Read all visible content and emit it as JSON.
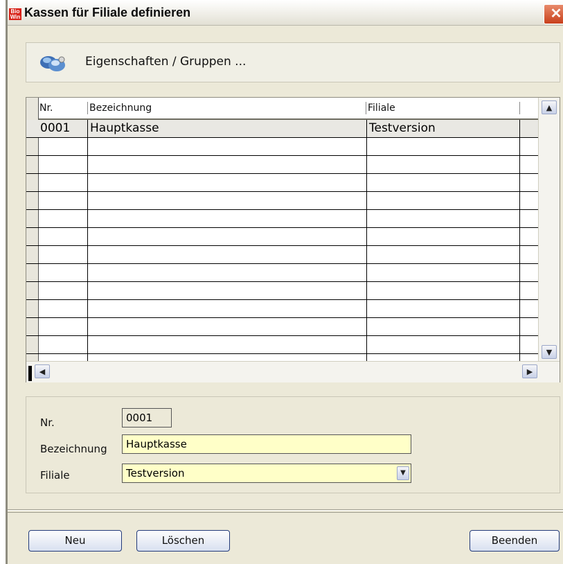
{
  "window": {
    "title": "Kassen für Filiale definieren",
    "app_icon_text": "Bio\nWin",
    "close_glyph": "✕"
  },
  "section": {
    "label": "Eigenschaften / Gruppen ...",
    "icon": "properties-icon"
  },
  "grid": {
    "columns": [
      "Nr.",
      "Bezeichnung",
      "Filiale"
    ],
    "rows": [
      {
        "nr": "0001",
        "bezeichnung": "Hauptkasse",
        "filiale": "Testversion"
      }
    ],
    "scroll_up": "▲",
    "scroll_down": "▼",
    "scroll_left": "◀",
    "scroll_right": "▶"
  },
  "detail": {
    "nr_label": "Nr.",
    "nr_value": "0001",
    "bezeichnung_label": "Bezeichnung",
    "bezeichnung_value": "Hauptkasse",
    "filiale_label": "Filiale",
    "filiale_value": "Testversion",
    "dropdown_glyph": "▼"
  },
  "buttons": {
    "neu": "Neu",
    "loeschen": "Löschen",
    "beenden": "Beenden"
  }
}
